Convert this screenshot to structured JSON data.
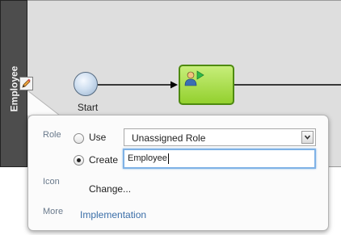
{
  "lane": {
    "name": "Employee"
  },
  "diagram": {
    "start_event_label": "Start"
  },
  "popover": {
    "role": {
      "label": "Role",
      "use_option_label": "Use",
      "use_selected": false,
      "select_value": "Unassigned Role",
      "create_option_label": "Create",
      "create_selected": true,
      "create_input_value": "Employee"
    },
    "icon": {
      "label": "Icon",
      "change_link": "Change..."
    },
    "more": {
      "label": "More",
      "implementation_link": "Implementation"
    }
  },
  "icons": {
    "lane_edit": "pencil-icon",
    "task_type": "user-task-icon",
    "dropdown": "chevron-down-icon"
  },
  "colors": {
    "lane_header": "#4d4d4d",
    "lane_body": "#dedede",
    "task_fill": "#a8dc4a",
    "task_border": "#4e8a10",
    "link": "#3a6ea8",
    "input_focus": "#7fb2e6"
  }
}
